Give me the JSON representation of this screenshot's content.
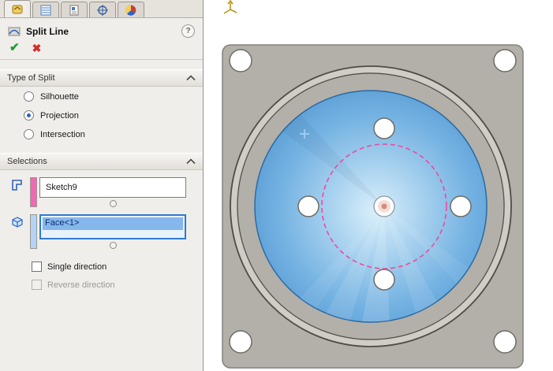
{
  "property_manager": {
    "tabs": [
      {
        "name": "features-tab"
      },
      {
        "name": "propertymanager-tab",
        "active": true
      },
      {
        "name": "configurations-tab"
      },
      {
        "name": "dimxpert-tab"
      },
      {
        "name": "display-tab"
      }
    ],
    "title": "Split Line",
    "help_label": "?",
    "ok_label": "✔",
    "cancel_label": "✖",
    "type_of_split": {
      "label": "Type of Split",
      "options": [
        {
          "label": "Silhouette",
          "selected": false
        },
        {
          "label": "Projection",
          "selected": true
        },
        {
          "label": "Intersection",
          "selected": false
        }
      ]
    },
    "selections": {
      "label": "Selections",
      "sketch_field": {
        "value": "Sketch9"
      },
      "face_field": {
        "value": "Face<1>",
        "focused": true,
        "selected": true
      },
      "single_direction": {
        "label": "Single direction",
        "checked": false
      },
      "reverse_direction": {
        "label": "Reverse direction",
        "checked": false,
        "disabled": true
      }
    }
  },
  "viewport": {
    "colors": {
      "plate": "#b3b0a9",
      "plate_edge": "#83817b",
      "groove_light": "#cfcdc6",
      "groove_dark": "#4e4d48",
      "face_center": "#d9effb",
      "face_mid": "#74b2e2",
      "face_edge": "#3d85c4",
      "face_border": "#2a6aa5",
      "hole_fill": "#ffffff",
      "hole_edge": "#6e6c66",
      "sketch_pink": "#f0479f",
      "center_point": "#d88b80",
      "cursor_cross": "#9dc9f0"
    }
  }
}
